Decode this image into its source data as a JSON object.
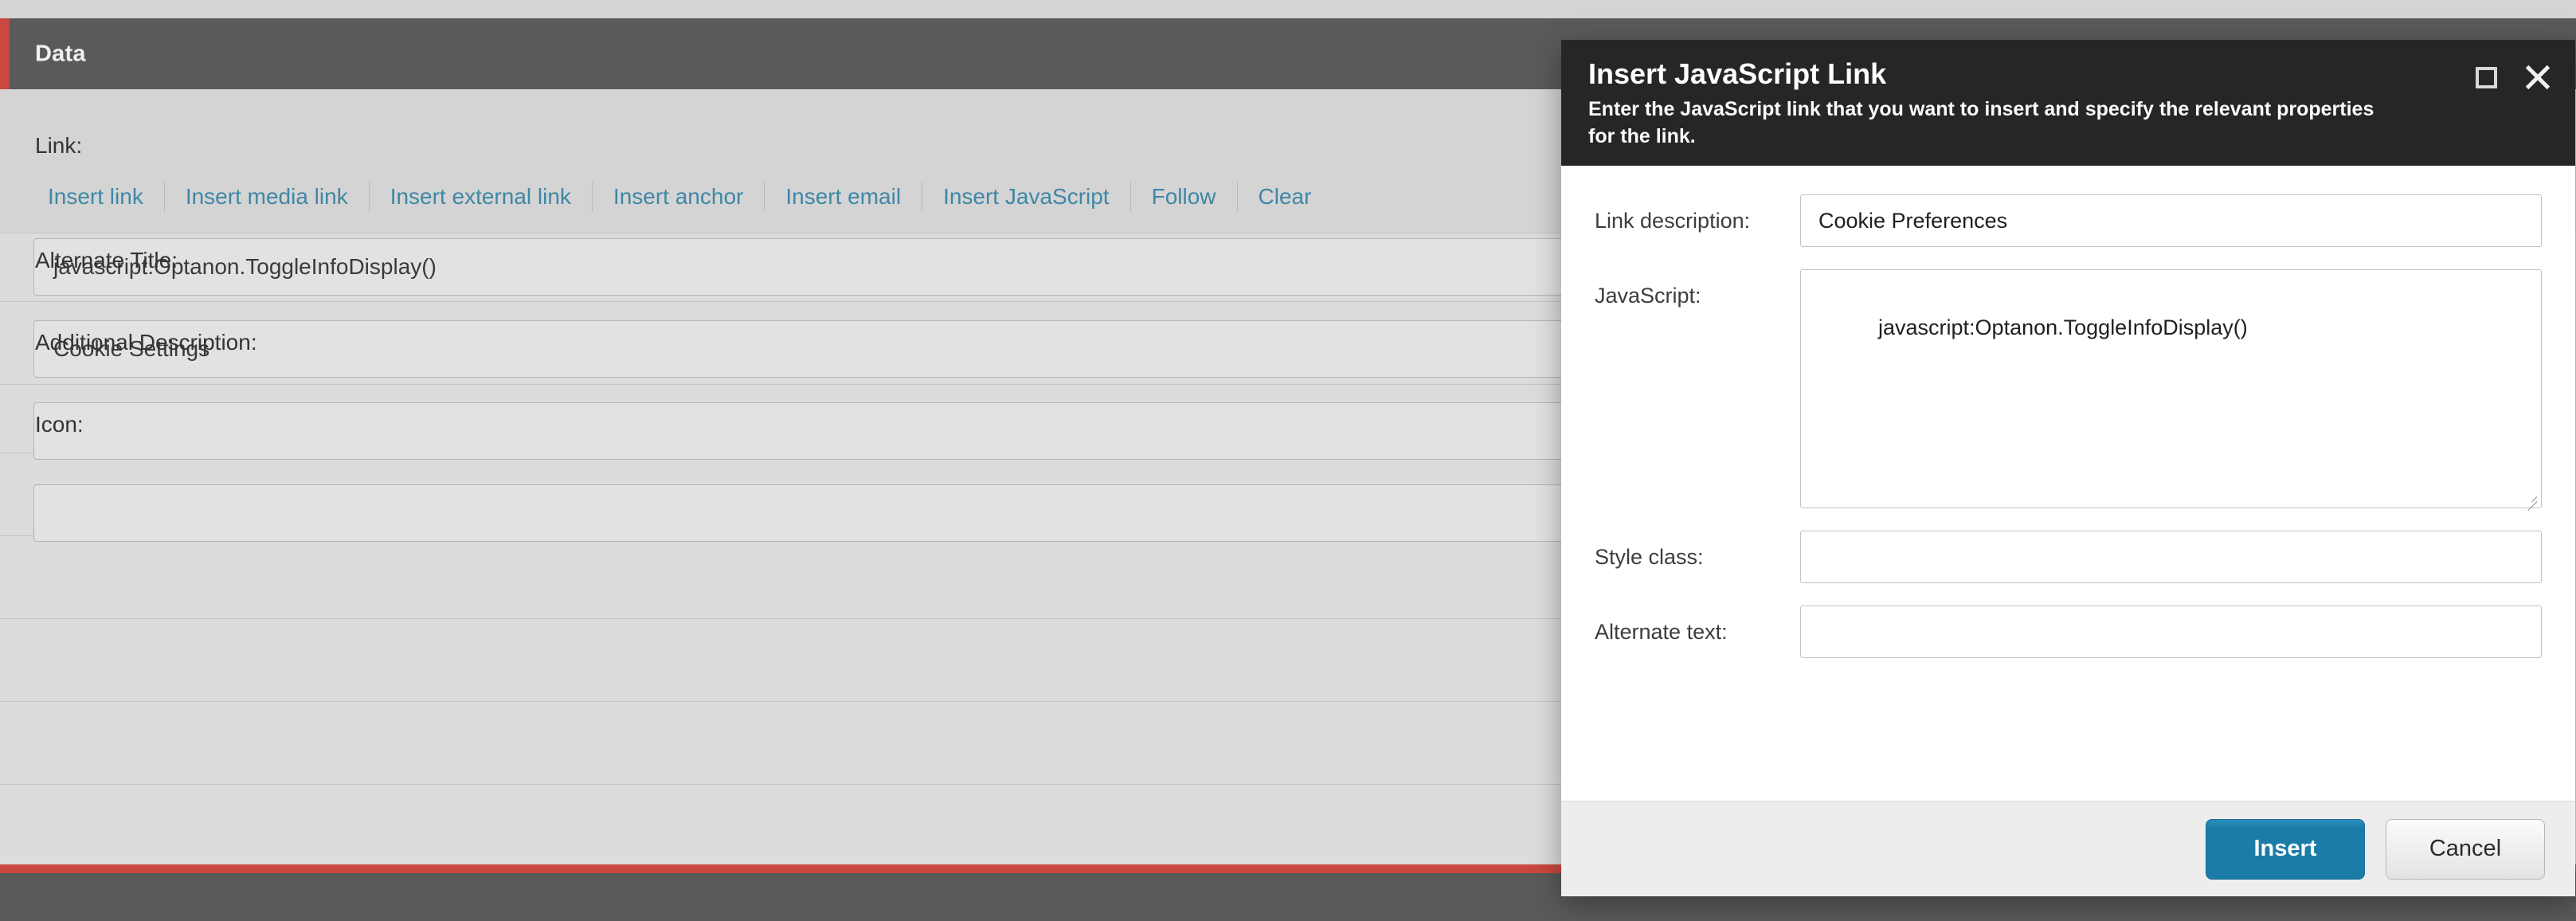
{
  "editor": {
    "header_title": "Data",
    "accent_color": "#c9483f",
    "fields": {
      "link_label": "Link:",
      "link_value": "javascript:Optanon.ToggleInfoDisplay()",
      "alternate_title_label": "Alternate Title:",
      "alternate_title_value": "Cookie Settings",
      "additional_description_label": "Additional Description:",
      "additional_description_value": "",
      "icon_label": "Icon:",
      "icon_value": ""
    },
    "link_actions": [
      {
        "label": "Insert link"
      },
      {
        "label": "Insert media link"
      },
      {
        "label": "Insert external link"
      },
      {
        "label": "Insert anchor"
      },
      {
        "label": "Insert email"
      },
      {
        "label": "Insert JavaScript"
      },
      {
        "label": "Follow"
      },
      {
        "label": "Clear"
      }
    ]
  },
  "dialog": {
    "title": "Insert JavaScript Link",
    "subtitle": "Enter the JavaScript link that you want to insert and specify the relevant properties for the link.",
    "maximize_icon": "maximize-icon",
    "close_icon": "close-icon",
    "fields": {
      "link_description_label": "Link description:",
      "link_description_value": "Cookie Preferences",
      "javascript_label": "JavaScript:",
      "javascript_value": "javascript:Optanon.ToggleInfoDisplay()",
      "style_class_label": "Style class:",
      "style_class_value": "",
      "alternate_text_label": "Alternate text:",
      "alternate_text_value": ""
    },
    "buttons": {
      "insert_label": "Insert",
      "cancel_label": "Cancel"
    },
    "accent_color": "#1b7ca8"
  }
}
